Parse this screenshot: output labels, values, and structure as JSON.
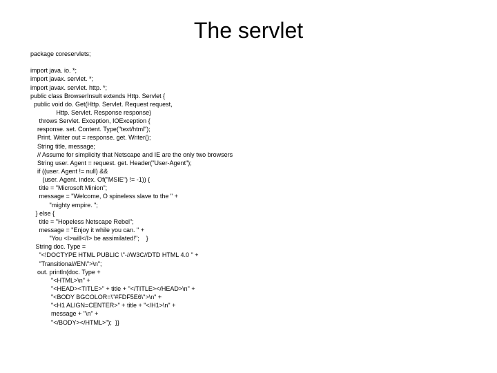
{
  "title": "The servlet",
  "code": "package coreservlets;\n\nimport java. io. *;\nimport javax. servlet. *;\nimport javax. servlet. http. *;\npublic class BrowserInsult extends Http. Servlet {\n  public void do. Get(Http. Servlet. Request request,\n               Http. Servlet. Response response)\n     throws Servlet. Exception, IOException {\n    response. set. Content. Type(\"text/html\");\n    Print. Writer out = response. get. Writer();\n    String title, message;\n    // Assume for simplicity that Netscape and IE are the only two browsers\n    String user. Agent = request. get. Header(\"User-Agent\");\n    if ((user. Agent != null) &&\n       (user. Agent. index. Of(\"MSIE\") != -1)) {\n     title = \"Microsoft Minion\";\n     message = \"Welcome, O spineless slave to the \" +\n           \"mighty empire. \";\n   } else {\n     title = \"Hopeless Netscape Rebel\";\n     message = \"Enjoy it while you can. \" +\n           \"You <I>will</I> be assimilated!\";    }\n   String doc. Type =\n     \"<!DOCTYPE HTML PUBLIC \\\"-//W3C//DTD HTML 4.0 \" +\n     \"Transitional//EN\\\">\\n\";\n    out. println(doc. Type +\n            \"<HTML>\\n\" +\n            \"<HEAD><TITLE>\" + title + \"</TITLE></HEAD>\\n\" +\n            \"<BODY BGCOLOR=\\\"#FDF5E6\\\">\\n\" +\n            \"<H1 ALIGN=CENTER>\" + title + \"</H1>\\n\" +\n            message + \"\\n\" +\n            \"</BODY></HTML>\");  }}"
}
